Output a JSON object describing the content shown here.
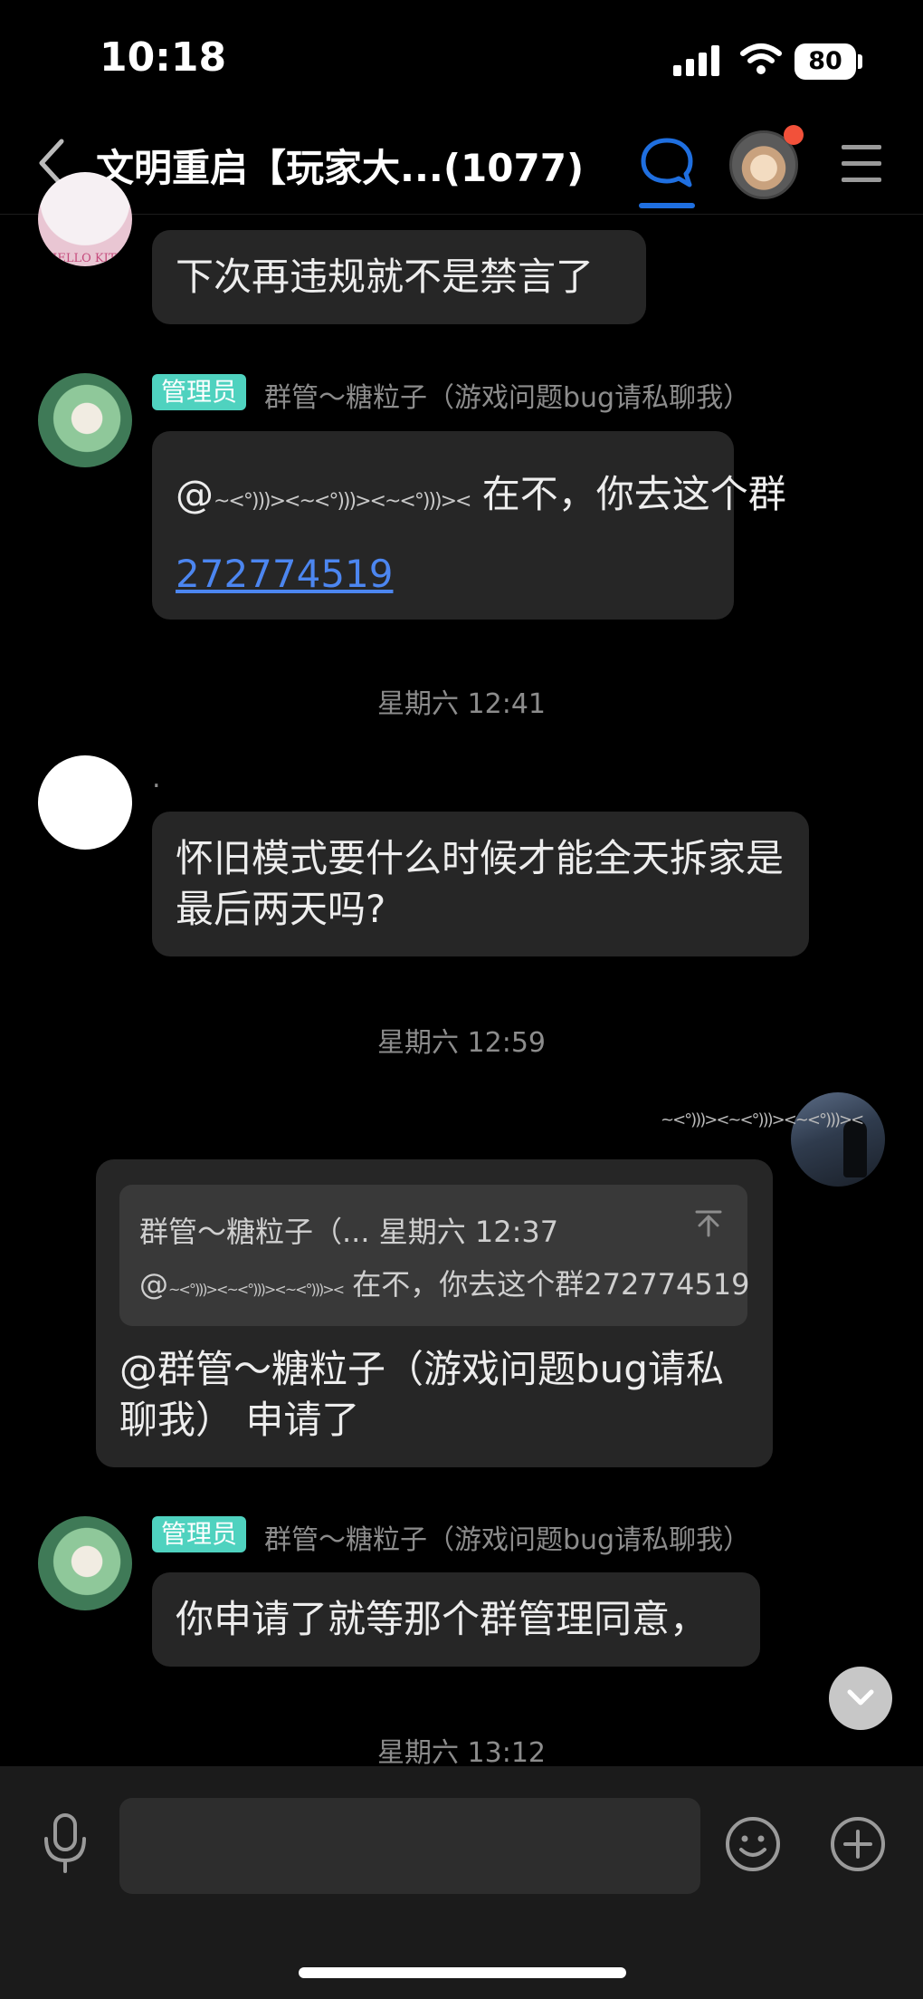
{
  "status": {
    "time": "10:18",
    "battery": "80"
  },
  "nav": {
    "title": "文明重启【玩家大...(1077)"
  },
  "messages": {
    "m1": {
      "text": "下次再违规就不是禁言了"
    },
    "m2": {
      "badge": "管理员",
      "sender": "群管～糖粒子（游戏问题bug请私聊我）",
      "mention_prefix": "@",
      "mention_name": "~<°)))><~<°)))><~<°)))><",
      "text": " 在不，你去这个群",
      "link": "272774519"
    },
    "t1": "星期六 12:41",
    "m3": {
      "sender": ".",
      "text": "怀旧模式要什么时候才能全天拆家是最后两天吗?"
    },
    "t2": "星期六 12:59",
    "m4": {
      "sender": "~<°)))><~<°)))><~<°)))><",
      "quote_header": "群管～糖粒子（... 星期六 12:37",
      "quote_prefix": "@",
      "quote_name": "~<°)))><~<°)))><~<°)))><",
      "quote_text": " 在不，你去这个群272774519",
      "text": "@群管～糖粒子（游戏问题bug请私聊我） 申请了"
    },
    "m5": {
      "badge": "管理员",
      "sender": "群管～糖粒子（游戏问题bug请私聊我）",
      "text": "你申请了就等那个群管理同意，"
    },
    "t3": "星期六 13:12"
  },
  "icons": {
    "back": "chevron-left-icon",
    "chat": "chat-bubble-icon",
    "menu": "menu-icon",
    "scroll": "chevron-down-icon",
    "mic": "microphone-icon",
    "emoji": "emoji-icon",
    "plus": "plus-icon",
    "pin": "pin-top-icon"
  },
  "colors": {
    "accent": "#1f6fe0",
    "admin_badge": "#4fd2bf",
    "link": "#4c86f0",
    "notify_dot": "#f2513a"
  }
}
